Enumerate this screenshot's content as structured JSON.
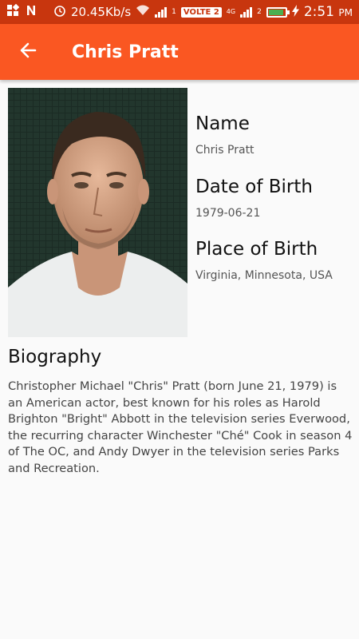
{
  "status_bar": {
    "speed": "20.45Kb/s",
    "network_badge": "VOLTE 2",
    "network_type": "4G",
    "sim_slot": "1",
    "sim_slot2": "2",
    "time": "2:51",
    "ampm": "PM",
    "battery_level": 0.9
  },
  "app_bar": {
    "title": "Chris Pratt",
    "back_icon": "arrow-back-icon",
    "color": "#fa5722"
  },
  "person": {
    "name_label": "Name",
    "name_value": "Chris Pratt",
    "dob_label": "Date of Birth",
    "dob_value": "1979-06-21",
    "pob_label": "Place of Birth",
    "pob_value": "Virginia, Minnesota, USA",
    "bio_label": "Biography",
    "bio_text": "Christopher Michael \"Chris\" Pratt (born June 21, 1979) is an American actor, best known for his roles as Harold Brighton \"Bright\" Abbott in the television series Everwood, the recurring character Winchester \"Ché\" Cook in season 4 of The OC, and Andy Dwyer in the television series Parks and Recreation."
  }
}
